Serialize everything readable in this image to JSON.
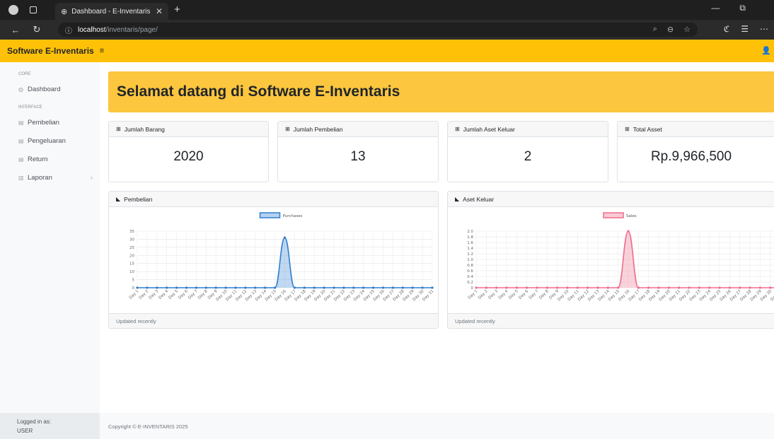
{
  "browser": {
    "tab_title": "Dashboard - E-Inventaris",
    "url_host": "localhost",
    "url_path": "/inventaris/page/"
  },
  "brand": "Software E-Inventaris",
  "sidebar": {
    "sections": [
      {
        "heading": "CORE",
        "items": [
          {
            "label": "Dashboard",
            "icon": "gauge-icon"
          }
        ]
      },
      {
        "heading": "INTERFACE",
        "items": [
          {
            "label": "Pembelian",
            "icon": "book-icon"
          },
          {
            "label": "Pengeluaran",
            "icon": "book-icon"
          },
          {
            "label": "Return",
            "icon": "book-icon"
          },
          {
            "label": "Laporan",
            "icon": "columns-icon"
          }
        ]
      }
    ],
    "footer_label": "Logged in as:",
    "footer_user": "USER"
  },
  "hero_title": "Selamat datang di Software E-Inventaris",
  "stats": [
    {
      "label": "Jumlah Barang",
      "value": "2020"
    },
    {
      "label": "Jumlah Pembelian",
      "value": "13"
    },
    {
      "label": "Jumlah Aset Keluar",
      "value": "2"
    },
    {
      "label": "Total Asset",
      "value": "Rp.9,966,500"
    }
  ],
  "charts_cards": [
    {
      "title": "Pembelian",
      "footer": "Updated recently"
    },
    {
      "title": "Aset Keluar",
      "footer": "Updated recently"
    }
  ],
  "footer": "Copyright © E-INVENTARIS 2025",
  "chart_data": [
    {
      "type": "area",
      "series": [
        {
          "name": "Purchases",
          "values": [
            0,
            0,
            0,
            0,
            0,
            0,
            0,
            0,
            0,
            0,
            0,
            0,
            0,
            0,
            0,
            31,
            0,
            0,
            0,
            0,
            0,
            0,
            0,
            0,
            0,
            0,
            0,
            0,
            0,
            0,
            0
          ],
          "color": "#2f7fd0"
        }
      ],
      "categories": [
        "Day 1",
        "Day 2",
        "Day 3",
        "Day 4",
        "Day 5",
        "Day 6",
        "Day 7",
        "Day 8",
        "Day 9",
        "Day 10",
        "Day 11",
        "Day 12",
        "Day 13",
        "Day 14",
        "Day 15",
        "Day 16",
        "Day 17",
        "Day 18",
        "Day 19",
        "Day 20",
        "Day 21",
        "Day 22",
        "Day 23",
        "Day 24",
        "Day 25",
        "Day 26",
        "Day 27",
        "Day 28",
        "Day 29",
        "Day 30",
        "Day 31"
      ],
      "yticks": [
        "35",
        "30",
        "25",
        "20",
        "15",
        "10",
        "5",
        "0"
      ],
      "ylim": [
        0,
        35
      ],
      "legend": "top",
      "grid": true
    },
    {
      "type": "area",
      "series": [
        {
          "name": "Sales",
          "values": [
            0,
            0,
            0,
            0,
            0,
            0,
            0,
            0,
            0,
            0,
            0,
            0,
            0,
            0,
            0,
            2,
            0,
            0,
            0,
            0,
            0,
            0,
            0,
            0,
            0,
            0,
            0,
            0,
            0,
            0,
            0
          ],
          "color": "#f06b8a"
        }
      ],
      "categories": [
        "Day 1",
        "Day 2",
        "Day 3",
        "Day 4",
        "Day 5",
        "Day 6",
        "Day 7",
        "Day 8",
        "Day 9",
        "Day 10",
        "Day 11",
        "Day 12",
        "Day 13",
        "Day 14",
        "Day 15",
        "Day 16",
        "Day 17",
        "Day 18",
        "Day 19",
        "Day 20",
        "Day 21",
        "Day 22",
        "Day 23",
        "Day 24",
        "Day 25",
        "Day 26",
        "Day 27",
        "Day 28",
        "Day 29",
        "Day 30",
        "Day 31"
      ],
      "yticks": [
        "2.0",
        "1.8",
        "1.6",
        "1.4",
        "1.2",
        "1.0",
        "0.8",
        "0.6",
        "0.4",
        "0.2",
        "0"
      ],
      "ylim": [
        0,
        2
      ],
      "legend": "top",
      "grid": true
    }
  ]
}
